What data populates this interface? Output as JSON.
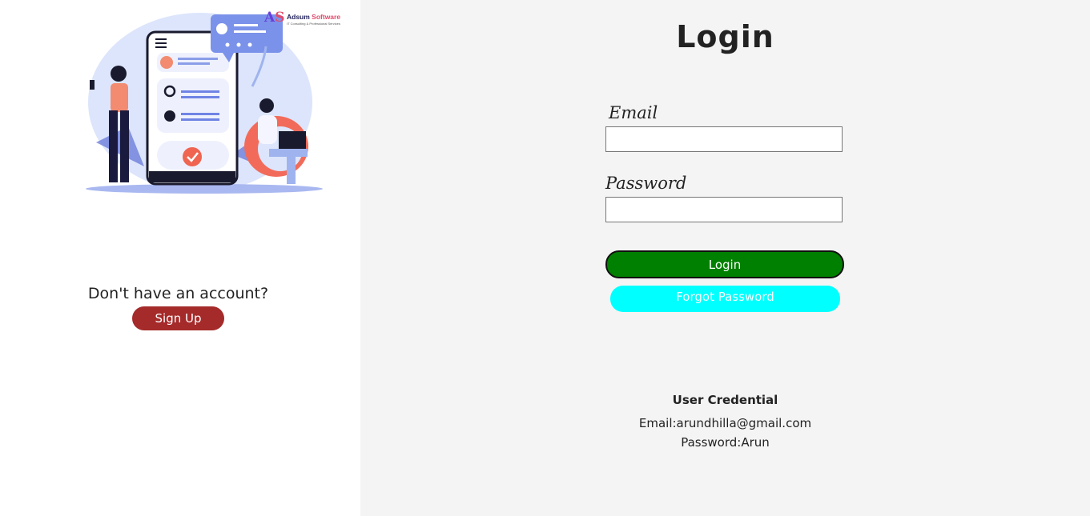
{
  "brand": {
    "mark_a": "A",
    "mark_s": "S",
    "name_first": "Adsum ",
    "name_second": "Software",
    "tagline": "IT Consulting & Professional Services"
  },
  "signup": {
    "prompt": "Don't have an account?",
    "button_label": "Sign Up"
  },
  "login_form": {
    "title": "Login",
    "email_label": "Email",
    "email_value": "",
    "password_label": "Password",
    "password_value": "",
    "login_button": "Login",
    "forgot_button": "Forgot Password"
  },
  "credentials": {
    "title": "User Credential",
    "email_line": "Email:arundhilla@gmail.com",
    "password_line": "Password:Arun"
  },
  "colors": {
    "login_button": "#008000",
    "forgot_button": "#00ffff",
    "signup_button": "#a52a2a",
    "right_panel_bg": "#f4f4f4"
  }
}
